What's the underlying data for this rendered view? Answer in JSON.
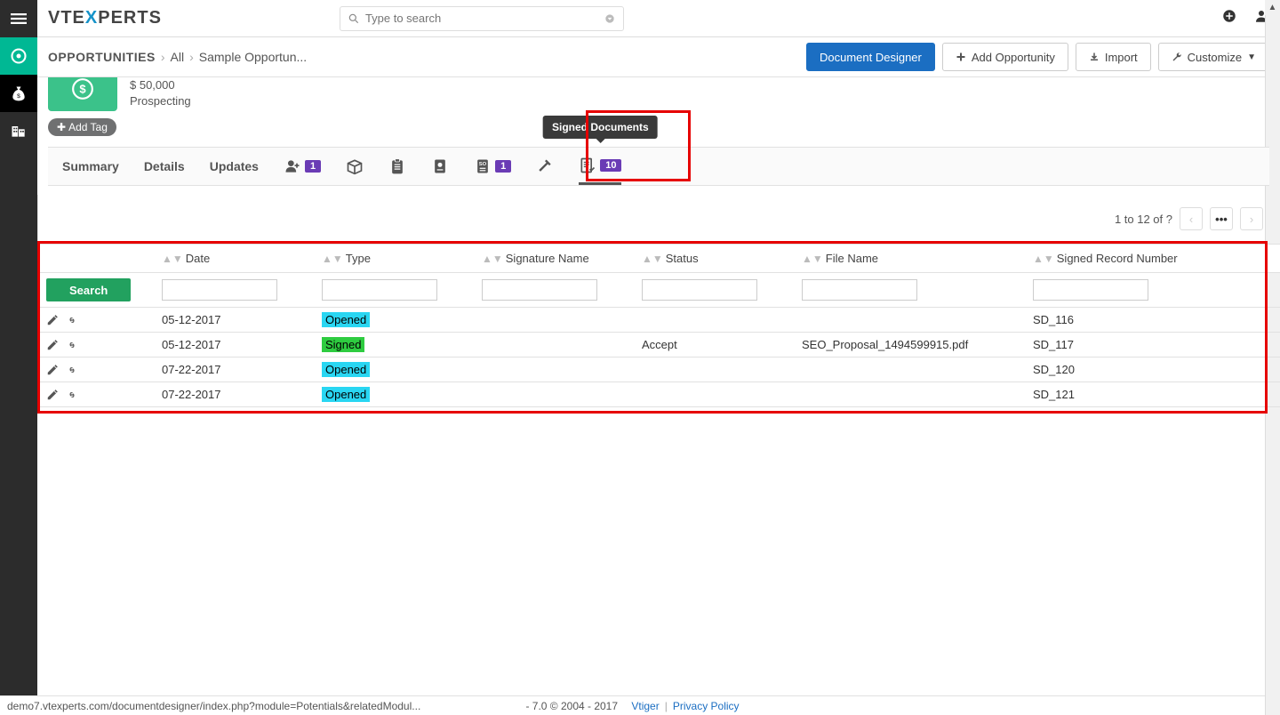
{
  "logo": {
    "pre": "VTE",
    "x": "X",
    "post": "PERTS"
  },
  "search": {
    "placeholder": "Type to search"
  },
  "breadcrumb": {
    "module": "OPPORTUNITIES",
    "all": "All",
    "record": "Sample Opportun..."
  },
  "actions": {
    "doc_designer": "Document Designer",
    "add_opp": "Add Opportunity",
    "import": "Import",
    "customize": "Customize"
  },
  "record": {
    "amount": "$ 50,000",
    "stage": "Prospecting",
    "add_tag": "Add Tag"
  },
  "tabs": {
    "summary": "Summary",
    "details": "Details",
    "updates": "Updates",
    "contacts_badge": "1",
    "so_badge": "1",
    "signed_badge": "10",
    "tooltip": "Signed Documents"
  },
  "pager": {
    "text": "1 to 12  of ?"
  },
  "table": {
    "headers": {
      "date": "Date",
      "type": "Type",
      "sig": "Signature Name",
      "status": "Status",
      "file": "File Name",
      "rec": "Signed Record Number"
    },
    "search_btn": "Search",
    "rows": [
      {
        "date": "05-12-2017",
        "type": "Opened",
        "type_class": "opened",
        "status": "",
        "file": "",
        "rec": "SD_116"
      },
      {
        "date": "05-12-2017",
        "type": "Signed",
        "type_class": "signed",
        "status": "Accept",
        "file": "SEO_Proposal_1494599915.pdf",
        "rec": "SD_117"
      },
      {
        "date": "07-22-2017",
        "type": "Opened",
        "type_class": "opened",
        "status": "",
        "file": "",
        "rec": "SD_120"
      },
      {
        "date": "07-22-2017",
        "type": "Opened",
        "type_class": "opened",
        "status": "",
        "file": "",
        "rec": "SD_121"
      }
    ]
  },
  "footer": {
    "status_url": "demo7.vtexperts.com/documentdesigner/index.php?module=Potentials&relatedModul...",
    "version": "- 7.0  © 2004 - 2017",
    "vtiger": "Vtiger",
    "privacy": "Privacy Policy"
  }
}
